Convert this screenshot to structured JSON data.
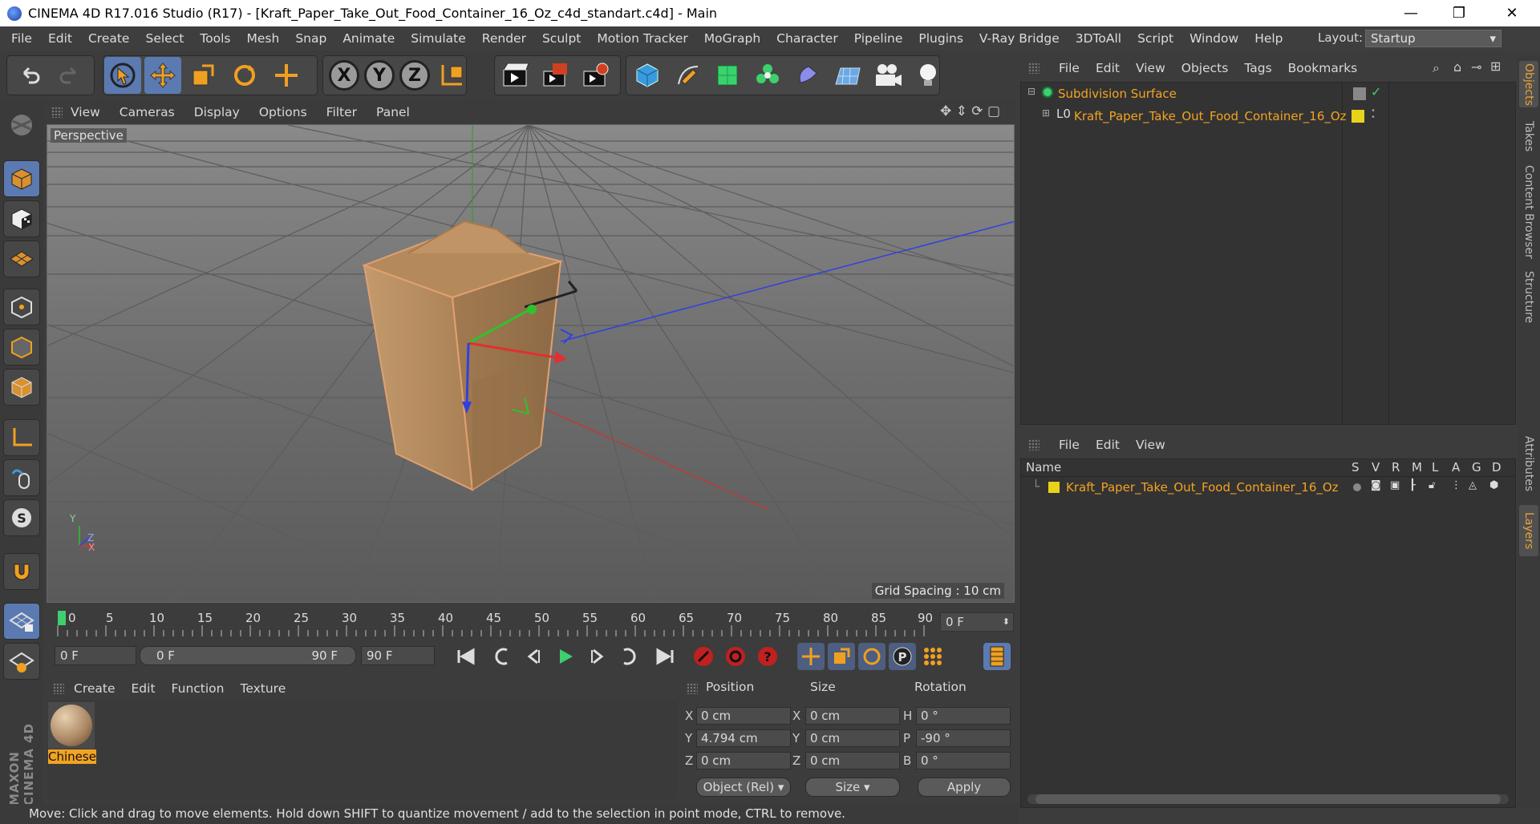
{
  "window": {
    "title": "CINEMA 4D R17.016 Studio (R17) - [Kraft_Paper_Take_Out_Food_Container_16_Oz_c4d_standart.c4d] - Main",
    "minimize": "—",
    "maximize": "❐",
    "close": "✕"
  },
  "menubar": {
    "items": [
      "File",
      "Edit",
      "Create",
      "Select",
      "Tools",
      "Mesh",
      "Snap",
      "Animate",
      "Simulate",
      "Render",
      "Sculpt",
      "Motion Tracker",
      "MoGraph",
      "Character",
      "Pipeline",
      "Plugins",
      "V-Ray Bridge",
      "3DToAll",
      "Script",
      "Window",
      "Help"
    ],
    "layout_label": "Layout:",
    "layout_value": "Startup"
  },
  "toolbar": {
    "axis_x": "X",
    "axis_y": "Y",
    "axis_z": "Z",
    "icons": [
      "undo-icon",
      "redo-icon",
      "live-select-icon",
      "move-icon",
      "scale-icon",
      "rotate-icon",
      "transform-icon",
      "axis-x-icon",
      "axis-y-icon",
      "axis-z-icon",
      "coordinate-system-icon",
      "render-view-icon",
      "render-picture-viewer-icon",
      "render-settings-icon",
      "cube-icon",
      "pen-icon",
      "subdivision-icon",
      "cloner-icon",
      "deformer-icon",
      "floor-icon",
      "camera-icon",
      "light-icon"
    ]
  },
  "viewport": {
    "menu": [
      "View",
      "Cameras",
      "Display",
      "Options",
      "Filter",
      "Panel"
    ],
    "label": "Perspective",
    "grid_spacing": "Grid Spacing : 10 cm",
    "axis_y": "Y",
    "axis_z": "Z",
    "axis_x": "X"
  },
  "timeline": {
    "ticks": [
      "0",
      "5",
      "10",
      "15",
      "20",
      "25",
      "30",
      "35",
      "40",
      "45",
      "50",
      "55",
      "60",
      "65",
      "70",
      "75",
      "80",
      "85",
      "90"
    ],
    "current_frame": "0 F"
  },
  "transport": {
    "start_field": "0 F",
    "range_start": "0 F",
    "range_end": "90 F",
    "end_field": "90 F"
  },
  "material_manager": {
    "menu": [
      "Create",
      "Edit",
      "Function",
      "Texture"
    ],
    "material_name": "Chinese"
  },
  "coordinates": {
    "headers": [
      "Position",
      "Size",
      "Rotation"
    ],
    "rows": [
      {
        "pos_label": "X",
        "pos": "0 cm",
        "size_label": "X",
        "size": "0 cm",
        "rot_label": "H",
        "rot": "0 °"
      },
      {
        "pos_label": "Y",
        "pos": "4.794 cm",
        "size_label": "Y",
        "size": "0 cm",
        "rot_label": "P",
        "rot": "-90 °"
      },
      {
        "pos_label": "Z",
        "pos": "0 cm",
        "size_label": "Z",
        "size": "0 cm",
        "rot_label": "B",
        "rot": "0 °"
      }
    ],
    "mode": "Object (Rel)",
    "size_mode": "Size",
    "apply": "Apply"
  },
  "status": "Move: Click and drag to move elements. Hold down SHIFT to quantize movement / add to the selection in point mode, CTRL to remove.",
  "object_manager": {
    "menu": [
      "File",
      "Edit",
      "View",
      "Objects",
      "Tags",
      "Bookmarks"
    ],
    "objects": [
      {
        "name": "Subdivision Surface"
      },
      {
        "name": "Kraft_Paper_Take_Out_Food_Container_16_Oz"
      }
    ]
  },
  "layer_manager": {
    "menu": [
      "File",
      "Edit",
      "View"
    ],
    "name_header": "Name",
    "columns": [
      "S",
      "V",
      "R",
      "M",
      "L",
      "A",
      "G",
      "D"
    ],
    "layers": [
      {
        "name": "Kraft_Paper_Take_Out_Food_Container_16_Oz"
      }
    ]
  },
  "side_tabs": [
    "Objects",
    "Takes",
    "Content Browser",
    "Structure",
    "Attributes",
    "Layers"
  ],
  "brand": "MAXON CINEMA 4D",
  "colors": {
    "accent": "#f3a322",
    "selected_tool": "#5b7ab1",
    "layer_color": "#e8d21a",
    "axis_x": "#e03030",
    "axis_y": "#30c030",
    "axis_z": "#3040e0"
  }
}
